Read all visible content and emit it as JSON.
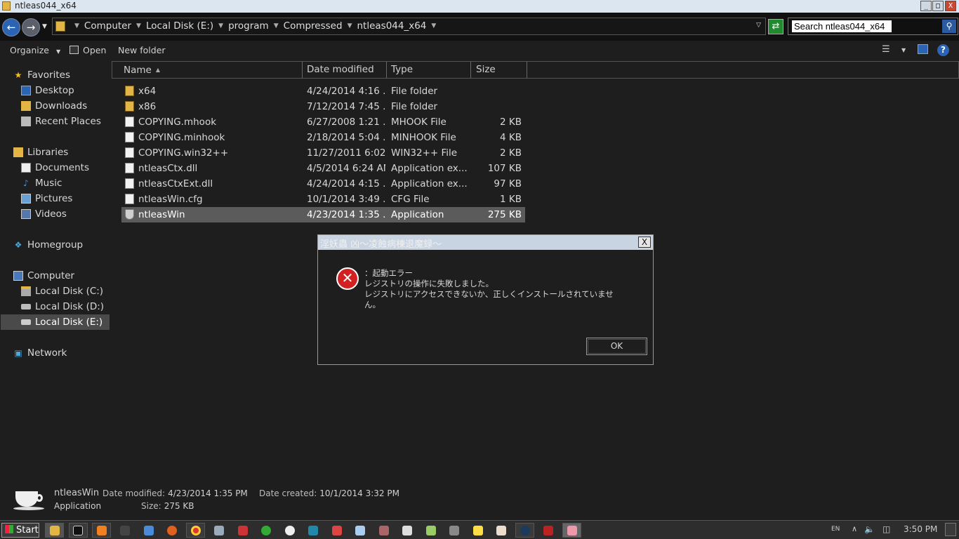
{
  "window": {
    "title": "ntleas044_x64",
    "buttons": [
      "_",
      "□",
      "X"
    ]
  },
  "address": {
    "crumbs": [
      "Computer",
      "Local Disk (E:)",
      "program",
      "Compressed",
      "ntleas044_x64"
    ],
    "search_value": "Search ntleas044_x64"
  },
  "toolbar": {
    "organize": "Organize",
    "open": "Open",
    "new_folder": "New folder"
  },
  "sidebar": {
    "favorites": "Favorites",
    "desktop": "Desktop",
    "downloads": "Downloads",
    "recent": "Recent Places",
    "libraries": "Libraries",
    "documents": "Documents",
    "music": "Music",
    "pictures": "Pictures",
    "videos": "Videos",
    "homegroup": "Homegroup",
    "computer": "Computer",
    "disk_c": "Local Disk (C:)",
    "disk_d": "Local Disk (D:)",
    "disk_e": "Local Disk (E:)",
    "network": "Network"
  },
  "columns": {
    "name": "Name",
    "date": "Date modified",
    "type": "Type",
    "size": "Size"
  },
  "files": [
    {
      "name": "x64",
      "date": "4/24/2014 4:16 ...",
      "type": "File folder",
      "size": "",
      "icon": "folder-icon"
    },
    {
      "name": "x86",
      "date": "7/12/2014 7:45 ...",
      "type": "File folder",
      "size": "",
      "icon": "folder-icon"
    },
    {
      "name": "COPYING.mhook",
      "date": "6/27/2008 1:21 ...",
      "type": "MHOOK File",
      "size": "2 KB",
      "icon": "file-icon"
    },
    {
      "name": "COPYING.minhook",
      "date": "2/18/2014 5:04 ...",
      "type": "MINHOOK File",
      "size": "4 KB",
      "icon": "file-icon"
    },
    {
      "name": "COPYING.win32++",
      "date": "11/27/2011 6:02...",
      "type": "WIN32++ File",
      "size": "2 KB",
      "icon": "file-icon"
    },
    {
      "name": "ntleasCtx.dll",
      "date": "4/5/2014 6:24 AM",
      "type": "Application ex...",
      "size": "107 KB",
      "icon": "dll-icon"
    },
    {
      "name": "ntleasCtxExt.dll",
      "date": "4/24/2014 4:15 ...",
      "type": "Application ex...",
      "size": "97 KB",
      "icon": "dll-icon"
    },
    {
      "name": "ntleasWin.cfg",
      "date": "10/1/2014 3:49 ...",
      "type": "CFG File",
      "size": "1 KB",
      "icon": "file-icon"
    },
    {
      "name": "ntleasWin",
      "date": "4/23/2014 1:35 ...",
      "type": "Application",
      "size": "275 KB",
      "icon": "exe-icon"
    }
  ],
  "dialog": {
    "title": "淫妖蟲 凶～凌蝕病棟退魔録～",
    "close": "X",
    "lines": [
      "：起動エラー",
      "レジストリの操作に失敗しました。",
      "レジストリにアクセスできないか、正しくインストールされていませ",
      "ん。"
    ],
    "ok": "OK"
  },
  "details": {
    "name": "ntleasWin",
    "kind": "Application",
    "modified_label": "Date modified:",
    "modified": "4/23/2014 1:35 PM",
    "size_label": "Size:",
    "size": "275 KB",
    "created_label": "Date created:",
    "created": "10/1/2014 3:32 PM"
  },
  "taskbar": {
    "start": "Start",
    "lang": "EN",
    "time": "3:50 PM"
  },
  "colors": {
    "background": "#1e1e1e",
    "selected_row": "#5b5b5b",
    "titlebar": "#dbe6f1",
    "error_red": "#d32020"
  }
}
